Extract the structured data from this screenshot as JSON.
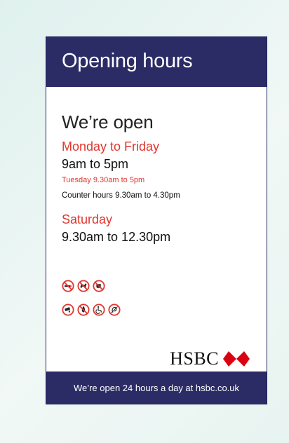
{
  "sign": {
    "title": "Opening hours",
    "open_heading": "We’re open",
    "schedule": {
      "weekday_label": "Monday to Friday",
      "weekday_hours": "9am to 5pm",
      "tuesday_note": "Tuesday 9.30am to 5pm",
      "counter_note": "Counter hours 9.30am to 4.30pm",
      "saturday_label": "Saturday",
      "saturday_hours": "9.30am to 12.30pm"
    },
    "prohibition_icons": [
      "no-smoking-icon",
      "no-dogs-icon",
      "no-eating-icon"
    ],
    "service_icons": [
      "cctv-icon",
      "no-open-flame-icon",
      "wheelchair-access-icon",
      "hearing-loop-icon"
    ],
    "logo_text": "HSBC",
    "footer": "We’re open 24 hours a day at hsbc.co.uk",
    "colors": {
      "navy": "#2b2c66",
      "red": "#e0362f",
      "background": "#dff1ee"
    }
  }
}
